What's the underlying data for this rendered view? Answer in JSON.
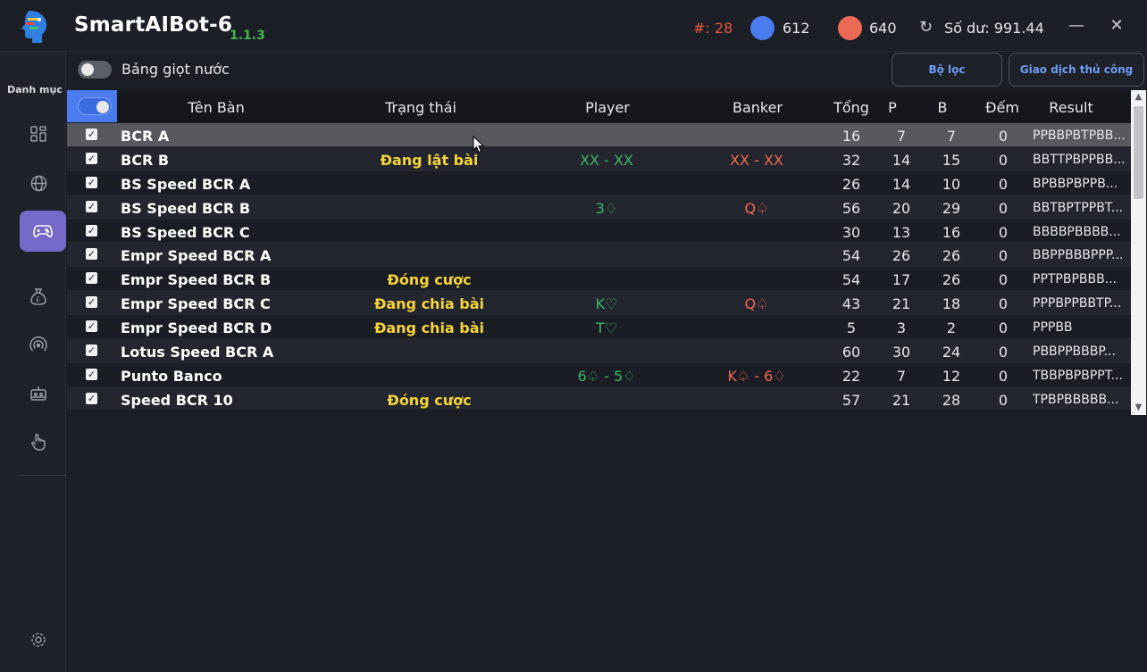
{
  "app": {
    "title": "SmartAIBot-6",
    "version": "1.1.3"
  },
  "header": {
    "hash_stat": "#: 28",
    "blue_count": "612",
    "red_count": "640",
    "balance": "Số dư: 991.44",
    "colors": {
      "blue": "#4a7cf0",
      "red": "#ea6a55"
    }
  },
  "sidebar": {
    "label": "Danh mục",
    "items": [
      {
        "icon": "dashboard-icon",
        "active": false
      },
      {
        "icon": "globe-icon",
        "active": false
      },
      {
        "icon": "gamepad-icon",
        "active": true
      },
      {
        "icon": "money-bag-icon",
        "active": false
      },
      {
        "icon": "signal-icon",
        "active": false
      },
      {
        "icon": "robot-icon",
        "active": false
      },
      {
        "icon": "hand-pointer-icon",
        "active": false
      },
      {
        "icon": "settings-icon",
        "active": false
      }
    ]
  },
  "toolbar": {
    "water_toggle_label": "Bảng giọt nước",
    "filter_button": "Bộ lọc",
    "manual_trade_button": "Giao dịch thủ công"
  },
  "table": {
    "columns": [
      "Tên Bàn",
      "Trạng thái",
      "Player",
      "Banker",
      "Tổng",
      "P",
      "B",
      "Đếm",
      "Result"
    ],
    "rows": [
      {
        "name": "BCR A",
        "status": "",
        "player": "",
        "banker": "",
        "total": "16",
        "p": "7",
        "b": "7",
        "count": "0",
        "result": "PPBBPBTPBB..."
      },
      {
        "name": "BCR B",
        "status": "Đang lật bài",
        "player": "XX - XX",
        "banker": "XX - XX",
        "total": "32",
        "p": "14",
        "b": "15",
        "count": "0",
        "result": "BBTTPBPPBB..."
      },
      {
        "name": "BS Speed BCR A",
        "status": "",
        "player": "",
        "banker": "",
        "total": "26",
        "p": "14",
        "b": "10",
        "count": "0",
        "result": "BPBBPBPPB..."
      },
      {
        "name": "BS Speed BCR B",
        "status": "",
        "player": "3♢",
        "banker": "Q♤",
        "total": "56",
        "p": "20",
        "b": "29",
        "count": "0",
        "result": "BBTBPTPPBT..."
      },
      {
        "name": "BS Speed BCR C",
        "status": "",
        "player": "",
        "banker": "",
        "total": "30",
        "p": "13",
        "b": "16",
        "count": "0",
        "result": "BBBBPBBBB..."
      },
      {
        "name": "Empr Speed BCR A",
        "status": "",
        "player": "",
        "banker": "",
        "total": "54",
        "p": "26",
        "b": "26",
        "count": "0",
        "result": "BBPPBBBPPP..."
      },
      {
        "name": "Empr Speed BCR B",
        "status": "Đóng cược",
        "player": "",
        "banker": "",
        "total": "54",
        "p": "17",
        "b": "26",
        "count": "0",
        "result": "PPTPBPBBB..."
      },
      {
        "name": "Empr Speed BCR C",
        "status": "Đang chia bài",
        "player": "K♡",
        "banker": "Q♤",
        "total": "43",
        "p": "21",
        "b": "18",
        "count": "0",
        "result": "PPPBPPBBTP..."
      },
      {
        "name": "Empr Speed BCR D",
        "status": "Đang chia bài",
        "player": "T♡",
        "banker": "",
        "total": "5",
        "p": "3",
        "b": "2",
        "count": "0",
        "result": "PPPBB"
      },
      {
        "name": "Lotus Speed BCR A",
        "status": "",
        "player": "",
        "banker": "",
        "total": "60",
        "p": "30",
        "b": "24",
        "count": "0",
        "result": "PBBPPBBBP..."
      },
      {
        "name": "Punto Banco",
        "status": "",
        "player": "6♤ - 5♢",
        "banker": "K♤ - 6♢",
        "total": "22",
        "p": "7",
        "b": "12",
        "count": "0",
        "result": "TBBPBPBPPT..."
      },
      {
        "name": "Speed BCR 10",
        "status": "Đóng cược",
        "player": "",
        "banker": "",
        "total": "57",
        "p": "21",
        "b": "28",
        "count": "0",
        "result": "TPBPBBBBB..."
      }
    ]
  }
}
